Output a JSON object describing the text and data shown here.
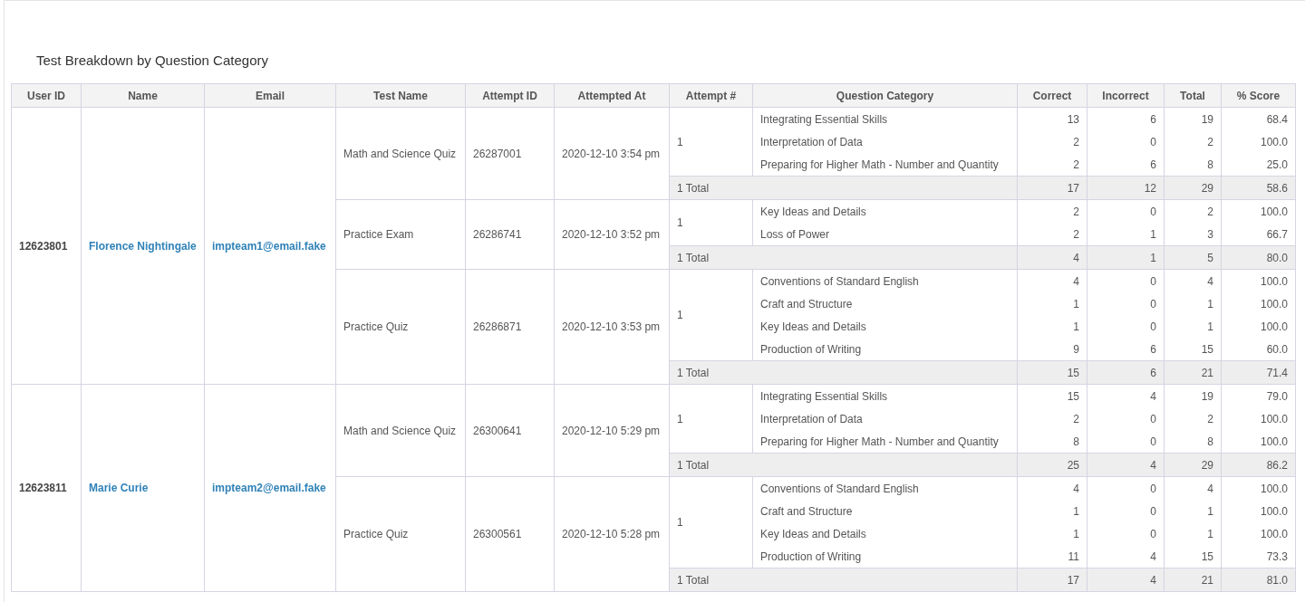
{
  "title": "Test Breakdown by Question Category",
  "columns": [
    "User ID",
    "Name",
    "Email",
    "Test Name",
    "Attempt ID",
    "Attempted At",
    "Attempt #",
    "Question Category",
    "Correct",
    "Incorrect",
    "Total",
    "% Score"
  ],
  "users": [
    {
      "user_id": "12623801",
      "name": "Florence Nightingale",
      "email": "impteam1@email.fake",
      "tests": [
        {
          "test_name": "Math and Science Quiz",
          "attempt_id": "26287001",
          "attempted_at": "2020-12-10 3:54 pm",
          "attempt": "1",
          "categories": [
            {
              "category": "Integrating Essential Skills",
              "correct": "13",
              "incorrect": "6",
              "total": "19",
              "score": "68.4"
            },
            {
              "category": "Interpretation of Data",
              "correct": "2",
              "incorrect": "0",
              "total": "2",
              "score": "100.0"
            },
            {
              "category": "Preparing for Higher Math - Number and Quantity",
              "correct": "2",
              "incorrect": "6",
              "total": "8",
              "score": "25.0"
            }
          ],
          "subtotal": {
            "label": "1 Total",
            "correct": "17",
            "incorrect": "12",
            "total": "29",
            "score": "58.6"
          }
        },
        {
          "test_name": "Practice Exam",
          "attempt_id": "26286741",
          "attempted_at": "2020-12-10 3:52 pm",
          "attempt": "1",
          "categories": [
            {
              "category": "Key Ideas and Details",
              "correct": "2",
              "incorrect": "0",
              "total": "2",
              "score": "100.0"
            },
            {
              "category": "Loss of Power",
              "correct": "2",
              "incorrect": "1",
              "total": "3",
              "score": "66.7"
            }
          ],
          "subtotal": {
            "label": "1 Total",
            "correct": "4",
            "incorrect": "1",
            "total": "5",
            "score": "80.0"
          }
        },
        {
          "test_name": "Practice Quiz",
          "attempt_id": "26286871",
          "attempted_at": "2020-12-10 3:53 pm",
          "attempt": "1",
          "categories": [
            {
              "category": "Conventions of Standard English",
              "correct": "4",
              "incorrect": "0",
              "total": "4",
              "score": "100.0"
            },
            {
              "category": "Craft and Structure",
              "correct": "1",
              "incorrect": "0",
              "total": "1",
              "score": "100.0"
            },
            {
              "category": "Key Ideas and Details",
              "correct": "1",
              "incorrect": "0",
              "total": "1",
              "score": "100.0"
            },
            {
              "category": "Production of Writing",
              "correct": "9",
              "incorrect": "6",
              "total": "15",
              "score": "60.0"
            }
          ],
          "subtotal": {
            "label": "1 Total",
            "correct": "15",
            "incorrect": "6",
            "total": "21",
            "score": "71.4"
          }
        }
      ]
    },
    {
      "user_id": "12623811",
      "name": "Marie Curie",
      "email": "impteam2@email.fake",
      "tests": [
        {
          "test_name": "Math and Science Quiz",
          "attempt_id": "26300641",
          "attempted_at": "2020-12-10 5:29 pm",
          "attempt": "1",
          "categories": [
            {
              "category": "Integrating Essential Skills",
              "correct": "15",
              "incorrect": "4",
              "total": "19",
              "score": "79.0"
            },
            {
              "category": "Interpretation of Data",
              "correct": "2",
              "incorrect": "0",
              "total": "2",
              "score": "100.0"
            },
            {
              "category": "Preparing for Higher Math - Number and Quantity",
              "correct": "8",
              "incorrect": "0",
              "total": "8",
              "score": "100.0"
            }
          ],
          "subtotal": {
            "label": "1 Total",
            "correct": "25",
            "incorrect": "4",
            "total": "29",
            "score": "86.2"
          }
        },
        {
          "test_name": "Practice Quiz",
          "attempt_id": "26300561",
          "attempted_at": "2020-12-10 5:28 pm",
          "attempt": "1",
          "categories": [
            {
              "category": "Conventions of Standard English",
              "correct": "4",
              "incorrect": "0",
              "total": "4",
              "score": "100.0"
            },
            {
              "category": "Craft and Structure",
              "correct": "1",
              "incorrect": "0",
              "total": "1",
              "score": "100.0"
            },
            {
              "category": "Key Ideas and Details",
              "correct": "1",
              "incorrect": "0",
              "total": "1",
              "score": "100.0"
            },
            {
              "category": "Production of Writing",
              "correct": "11",
              "incorrect": "4",
              "total": "15",
              "score": "73.3"
            }
          ],
          "subtotal": {
            "label": "1 Total",
            "correct": "17",
            "incorrect": "4",
            "total": "21",
            "score": "81.0"
          }
        }
      ]
    }
  ]
}
